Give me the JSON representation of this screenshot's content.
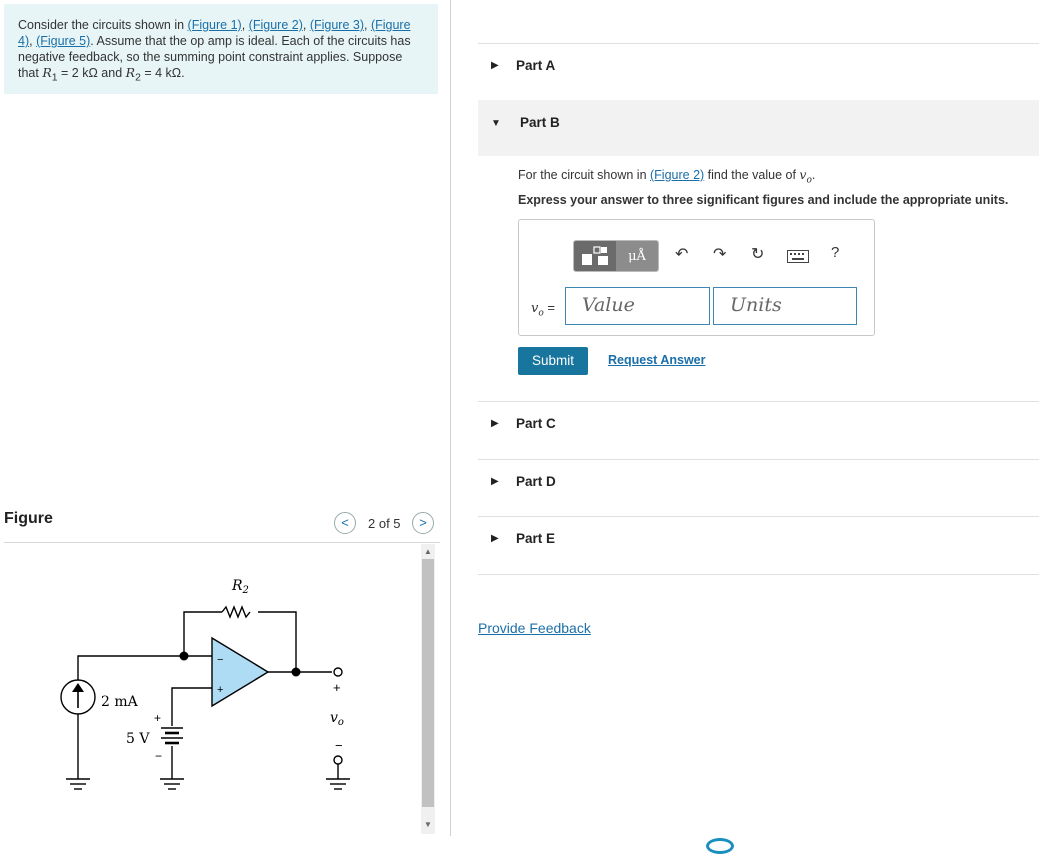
{
  "problem": {
    "intro": "Consider the circuits shown in",
    "figure_links": [
      "(Figure 1)",
      "(Figure 2)",
      "(Figure 3)",
      "(Figure 4)",
      "(Figure 5)"
    ],
    "body": ". Assume that the op amp is ideal. Each of the circuits has negative feedback, so the summing point constraint applies. Suppose that",
    "r1_sym": "R",
    "r1_sub": "1",
    "r1_val": " = 2 kΩ and ",
    "r2_sym": "R",
    "r2_sub": "2",
    "r2_val": " = 4 kΩ."
  },
  "figure": {
    "title": "Figure",
    "counter": "2 of 5",
    "prev_glyph": "<",
    "next_glyph": ">",
    "circuit": {
      "resistor_label": "R",
      "resistor_sub": "2",
      "current_source": "2 mA",
      "voltage_source": "5 V",
      "output_var": "v",
      "output_sub": "o",
      "plus": "+",
      "minus": "−"
    }
  },
  "parts": {
    "a": "Part A",
    "b": "Part B",
    "c": "Part C",
    "d": "Part D",
    "e": "Part E"
  },
  "partB": {
    "question_pre": "For the circuit shown in ",
    "question_link": "(Figure 2)",
    "question_post": " find the value of ",
    "question_var": "v",
    "question_sub": "o",
    "question_end": ".",
    "instruction": "Express your answer to three significant figures and include the appropriate units.",
    "var_label": "v",
    "var_sub": "o",
    "var_eq": " =",
    "value_placeholder": "Value",
    "units_placeholder": "Units",
    "units_button": "μÅ",
    "help_glyph": "?",
    "submit": "Submit",
    "request_answer": "Request Answer"
  },
  "footer": {
    "feedback": "Provide Feedback"
  },
  "icons": [
    "template-icon",
    "undo-icon",
    "redo-icon",
    "reset-icon",
    "keyboard-icon",
    "help-icon",
    "triangle-right-icon",
    "triangle-down-icon"
  ],
  "colors": {
    "accent": "#17759e",
    "link": "#1b6fa8",
    "problem_bg": "#e8f5f7",
    "opamp_fill": "#aedcf5"
  }
}
